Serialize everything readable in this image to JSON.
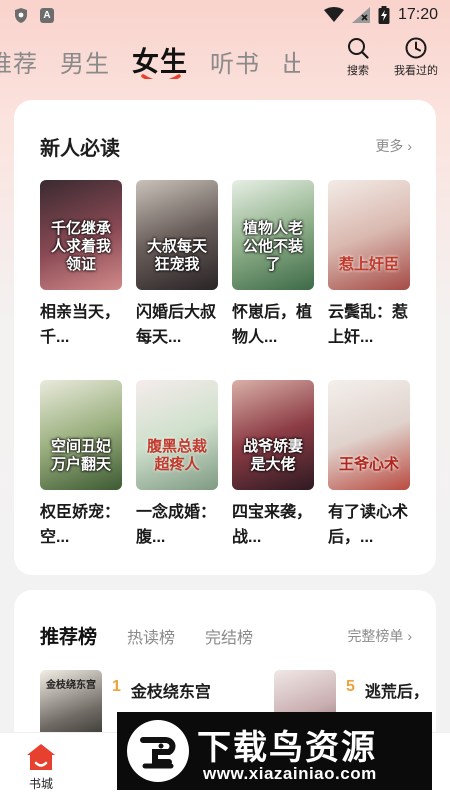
{
  "status_bar": {
    "time": "17:20",
    "app_badge": "A"
  },
  "top_nav": {
    "tabs": [
      {
        "label": "推荐"
      },
      {
        "label": "男生"
      },
      {
        "label": "女生"
      },
      {
        "label": "听书"
      },
      {
        "label": "出版"
      }
    ],
    "active_tab": "女生",
    "search_label": "搜索",
    "history_label": "我看过的"
  },
  "new_reader": {
    "title": "新人必读",
    "more_label": "更多 ›",
    "books": [
      {
        "title": "相亲当天，千...",
        "cover_text": "千亿继承人求着我领证",
        "cover_color": "#7a3e4a"
      },
      {
        "title": "闪婚后大叔每天...",
        "cover_text": "大叔每天狂宠我",
        "cover_color": "#5a5050"
      },
      {
        "title": "怀崽后，植物人...",
        "cover_text": "植物人老公他不装了",
        "cover_color": "#6c8a6a"
      },
      {
        "title": "云鬓乱：惹上奸...",
        "cover_text": "惹上奸臣",
        "cover_color": "#d9c9c2"
      },
      {
        "title": "权臣娇宠：空...",
        "cover_text": "空间丑妃万户翻天",
        "cover_color": "#5d7a4e"
      },
      {
        "title": "一念成婚：腹...",
        "cover_text": "腹黑总裁超疼人",
        "cover_color": "#c9dcc6"
      },
      {
        "title": "四宝来袭，战...",
        "cover_text": "战爷娇妻是大佬",
        "cover_color": "#7a3440"
      },
      {
        "title": "有了读心术后，...",
        "cover_text": "王爷心术",
        "cover_color": "#e9e4df"
      }
    ]
  },
  "rank": {
    "tabs": [
      {
        "label": "推荐榜"
      },
      {
        "label": "热读榜"
      },
      {
        "label": "完结榜"
      }
    ],
    "more_label": "完整榜单 ›",
    "items": [
      {
        "num": "1",
        "name": "金枝绕东宫",
        "cover_text": "金枝绕东宫"
      },
      {
        "num": "5",
        "name": "逃荒后，",
        "cover_text": ""
      }
    ]
  },
  "bottom_nav": {
    "home_label": "书城"
  },
  "watermark": {
    "brand": "下载鸟资源",
    "url": "www.xiazainiao.com"
  }
}
